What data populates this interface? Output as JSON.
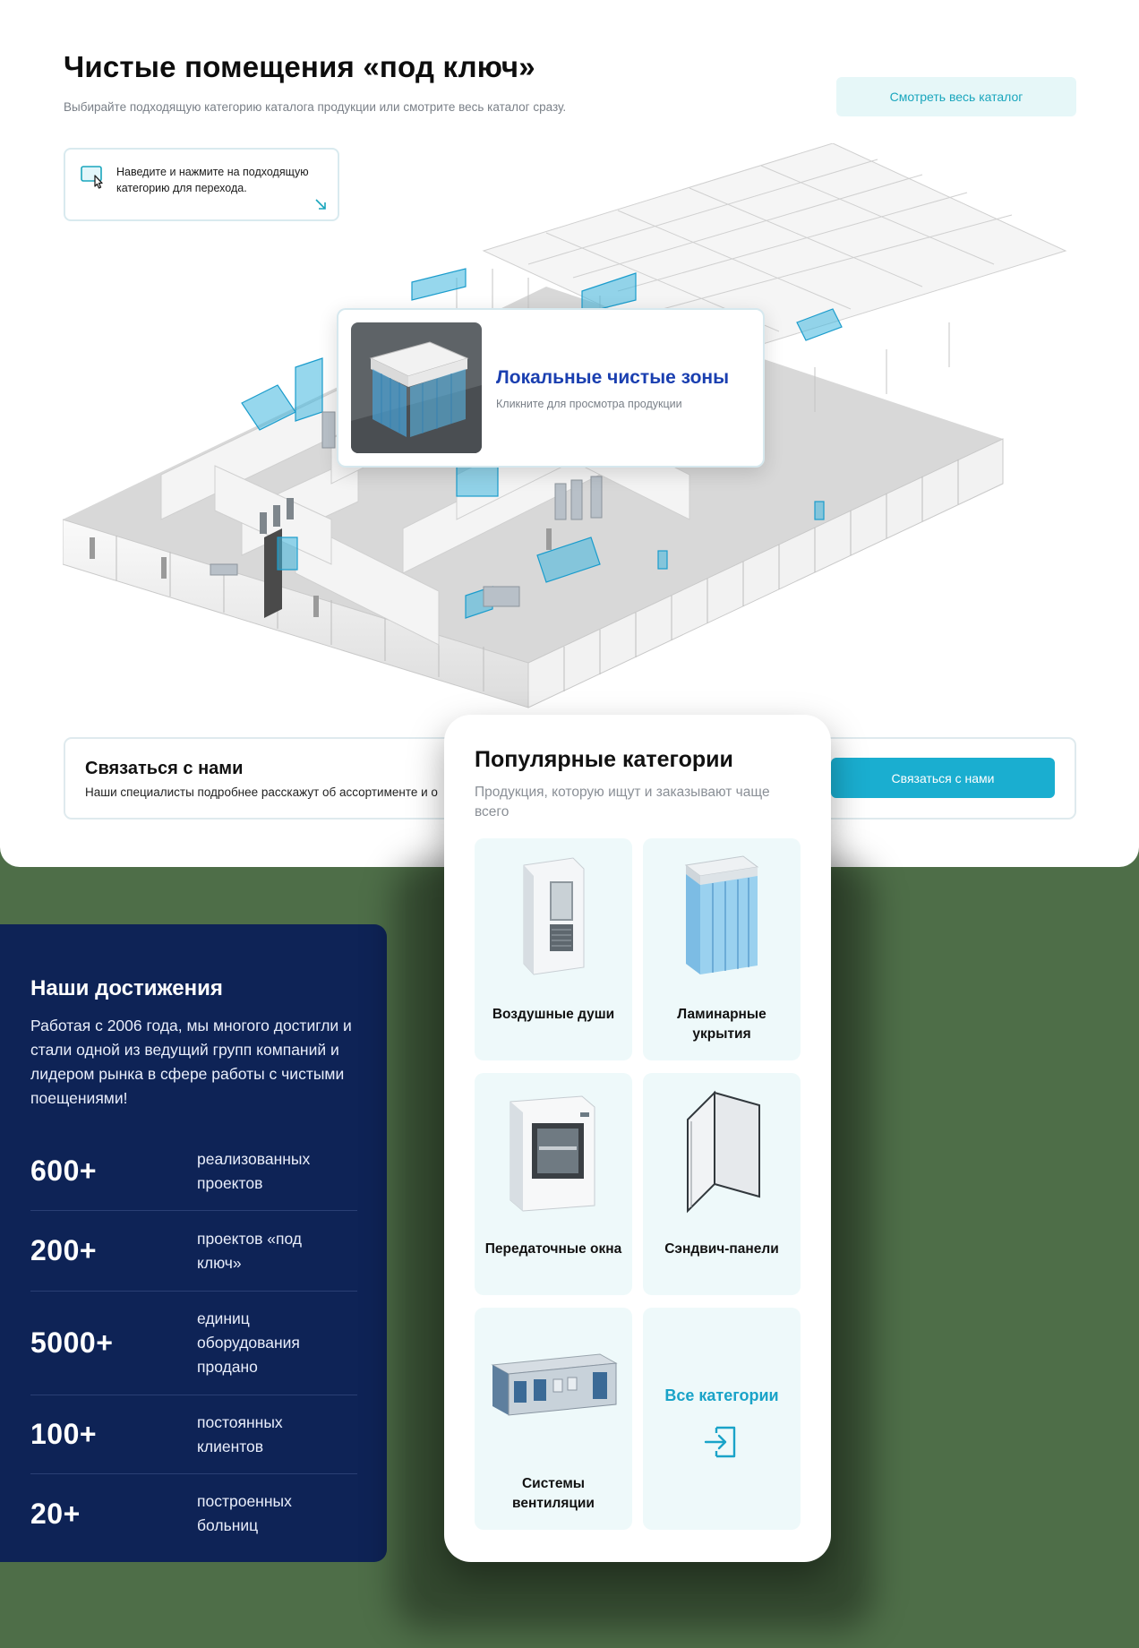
{
  "header": {
    "title": "Чистые помещения «под ключ»",
    "subtitle": "Выбирайте подходящую категорию каталога продукции или смотрите весь каталог сразу.",
    "catalog_button": "Смотреть весь каталог"
  },
  "hint": {
    "text": "Наведите и нажмите на подходящую категорию для перехода."
  },
  "zone_popup": {
    "title": "Локальные чистые зоны",
    "subtitle": "Кликните для просмотра продукции"
  },
  "contact": {
    "title": "Связаться с нами",
    "subtitle": "Наши специалисты подробнее расскажут об ассортименте и о",
    "button": "Связаться с нами"
  },
  "achievements": {
    "title": "Наши достижения",
    "text": "Работая с 2006 года, мы многого достигли и стали одной из ведущий групп компаний и лидером рынка в сфере работы с чистыми поещениями!",
    "items": [
      {
        "number": "600+",
        "label": "реализованных проектов"
      },
      {
        "number": "200+",
        "label": "проектов «под ключ»"
      },
      {
        "number": "5000+",
        "label": "единиц оборудования продано"
      },
      {
        "number": "100+",
        "label": "постоянных клиентов"
      },
      {
        "number": "20+",
        "label": "построенных больниц"
      }
    ]
  },
  "popular": {
    "title": "Популярные категории",
    "subtitle": "Продукция, которую ищут и заказывают чаще всего",
    "categories": [
      {
        "label": "Воздушные души",
        "icon": "air-shower-icon"
      },
      {
        "label": "Ламинарные укрытия",
        "icon": "laminar-hood-icon"
      },
      {
        "label": "Передаточные окна",
        "icon": "pass-box-icon"
      },
      {
        "label": "Сэндвич-панели",
        "icon": "sandwich-panel-icon"
      },
      {
        "label": "Системы вентиляции",
        "icon": "ventilation-unit-icon"
      }
    ],
    "all_categories": "Все категории"
  },
  "colors": {
    "accent": "#1aaed0",
    "accent_dark": "#1a3fb0",
    "achievements_bg": "#0e2356",
    "category_bg": "#eef9fa"
  }
}
